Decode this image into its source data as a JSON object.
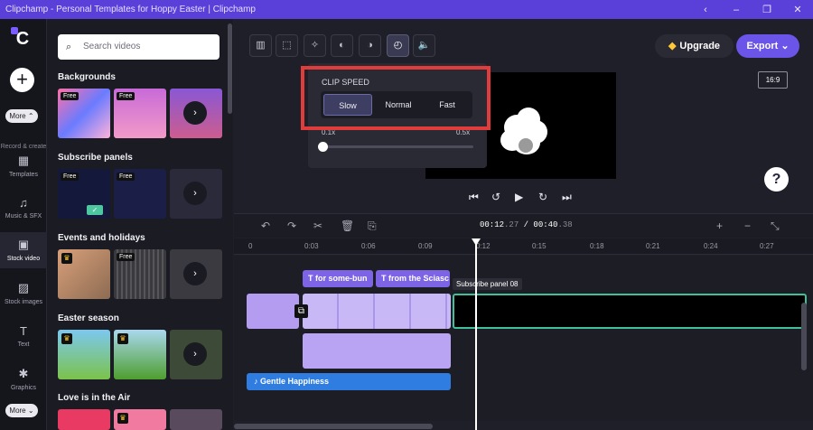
{
  "titlebar": {
    "title": "Clipchamp - Personal Templates for Hoppy Easter | Clipchamp"
  },
  "rail": {
    "logo": "C",
    "more_label": "More",
    "more2_label": "More",
    "sub_label": "Record & create",
    "items": [
      {
        "label": "Templates"
      },
      {
        "label": "Music & SFX"
      },
      {
        "label": "Stock video"
      },
      {
        "label": "Stock images"
      },
      {
        "label": "Text"
      },
      {
        "label": "Graphics"
      }
    ]
  },
  "panel": {
    "search_placeholder": "Search videos",
    "sections": [
      {
        "title": "Backgrounds"
      },
      {
        "title": "Subscribe panels"
      },
      {
        "title": "Events and holidays"
      },
      {
        "title": "Easter season"
      },
      {
        "title": "Love is in the Air"
      }
    ],
    "free_label": "Free"
  },
  "toolbar": {
    "upgrade_label": "Upgrade",
    "export_label": "Export"
  },
  "speed": {
    "header": "CLIP SPEED",
    "options": [
      "Slow",
      "Normal",
      "Fast"
    ],
    "selected": "Slow",
    "min_label": "0.1x",
    "max_label": "0.5x",
    "value": 0
  },
  "preview": {
    "aspect": "16:9"
  },
  "timeline": {
    "current": "00:12",
    "current_frac": ".27",
    "total": "00:40",
    "total_frac": ".38",
    "ticks": [
      "0",
      "0:03",
      "0:06",
      "0:09",
      "0:12",
      "0:15",
      "0:18",
      "0:21",
      "0:24",
      "0:27"
    ],
    "text_clip_1": "for some-bun",
    "text_clip_2": "from the Sciasc",
    "tooltip": "Subscribe panel 08",
    "audio_label": "Gentle Happiness"
  },
  "colors": {
    "accent": "#6b54e8",
    "titlebar": "#5b3fd9",
    "highlight": "#e03c3c",
    "audio": "#2f7de0"
  }
}
